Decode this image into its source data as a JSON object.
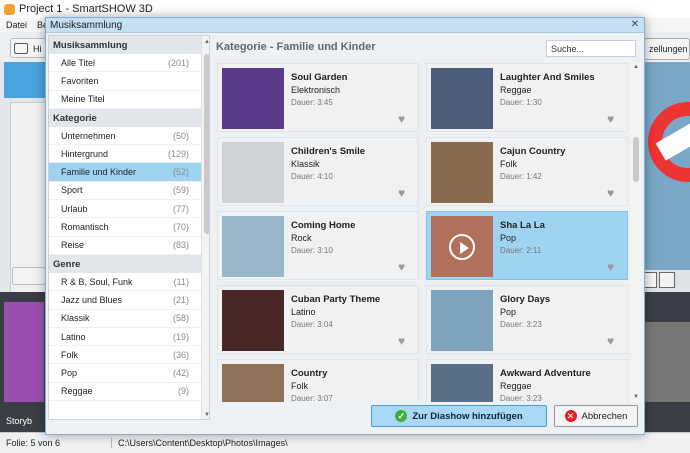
{
  "app": {
    "title": "Project 1 - SmartSHOW 3D"
  },
  "menu": {
    "items": [
      "Datei",
      "Be"
    ]
  },
  "background": {
    "hi_button": "Hi",
    "right_button": "zellungen",
    "storyboard": "Storyb"
  },
  "status": {
    "slide": "Folie: 5 von 6",
    "path": "C:\\Users\\Content\\Desktop\\Photos\\Images\\"
  },
  "dialog": {
    "title": "Musiksammlung",
    "close": "✕",
    "search_placeholder": "Suche...",
    "heading": "Kategorie - Familie und Kinder",
    "add_button": "Zur Diashow hinzufügen",
    "cancel_button": "Abbrechen"
  },
  "sidebar": {
    "sections": [
      {
        "title": "Musiksammlung",
        "items": [
          {
            "label": "Alle Titel",
            "count": "(201)"
          },
          {
            "label": "Favoriten",
            "count": ""
          },
          {
            "label": "Meine Titel",
            "count": ""
          }
        ]
      },
      {
        "title": "Kategorie",
        "items": [
          {
            "label": "Unternehmen",
            "count": "(50)"
          },
          {
            "label": "Hintergrund",
            "count": "(129)"
          },
          {
            "label": "Familie und Kinder",
            "count": "(52)",
            "selected": true
          },
          {
            "label": "Sport",
            "count": "(59)"
          },
          {
            "label": "Urlaub",
            "count": "(77)"
          },
          {
            "label": "Romantisch",
            "count": "(70)"
          },
          {
            "label": "Reise",
            "count": "(83)"
          }
        ]
      },
      {
        "title": "Genre",
        "items": [
          {
            "label": "R & B, Soul, Funk",
            "count": "(11)"
          },
          {
            "label": "Jazz und Blues",
            "count": "(21)"
          },
          {
            "label": "Klassik",
            "count": "(58)"
          },
          {
            "label": "Latino",
            "count": "(19)"
          },
          {
            "label": "Folk",
            "count": "(36)"
          },
          {
            "label": "Pop",
            "count": "(42)"
          },
          {
            "label": "Reggae",
            "count": "(9)"
          }
        ]
      }
    ]
  },
  "tracks": [
    {
      "title": "Soul Garden",
      "genre": "Elektronisch",
      "duration": "Dauer: 3:45",
      "thumb_color": "#5a3a8a"
    },
    {
      "title": "Laughter And Smiles",
      "genre": "Reggae",
      "duration": "Dauer: 1:30",
      "thumb_color": "#4b5d78"
    },
    {
      "title": "Children's Smile",
      "genre": "Klassik",
      "duration": "Dauer: 4:10",
      "thumb_color": "#cfd3d6"
    },
    {
      "title": "Cajun Country",
      "genre": "Folk",
      "duration": "Dauer: 1:42",
      "thumb_color": "#8b6b4e"
    },
    {
      "title": "Coming Home",
      "genre": "Rock",
      "duration": "Dauer: 3:10",
      "thumb_color": "#9ab6c9"
    },
    {
      "title": "Sha La La",
      "genre": "Pop",
      "duration": "Dauer: 2:11",
      "thumb_color": "#b0705a",
      "selected": true,
      "playing": true
    },
    {
      "title": "Cuban Party Theme",
      "genre": "Latino",
      "duration": "Dauer: 3:04",
      "thumb_color": "#4a2626"
    },
    {
      "title": "Glory Days",
      "genre": "Pop",
      "duration": "Dauer: 3:23",
      "thumb_color": "#7da3bd"
    },
    {
      "title": "Country",
      "genre": "Folk",
      "duration": "Dauer: 3:07",
      "thumb_color": "#8f7358"
    },
    {
      "title": "Awkward Adventure",
      "genre": "Reggae",
      "duration": "Dauer: 3:23",
      "thumb_color": "#5a6e86"
    }
  ]
}
